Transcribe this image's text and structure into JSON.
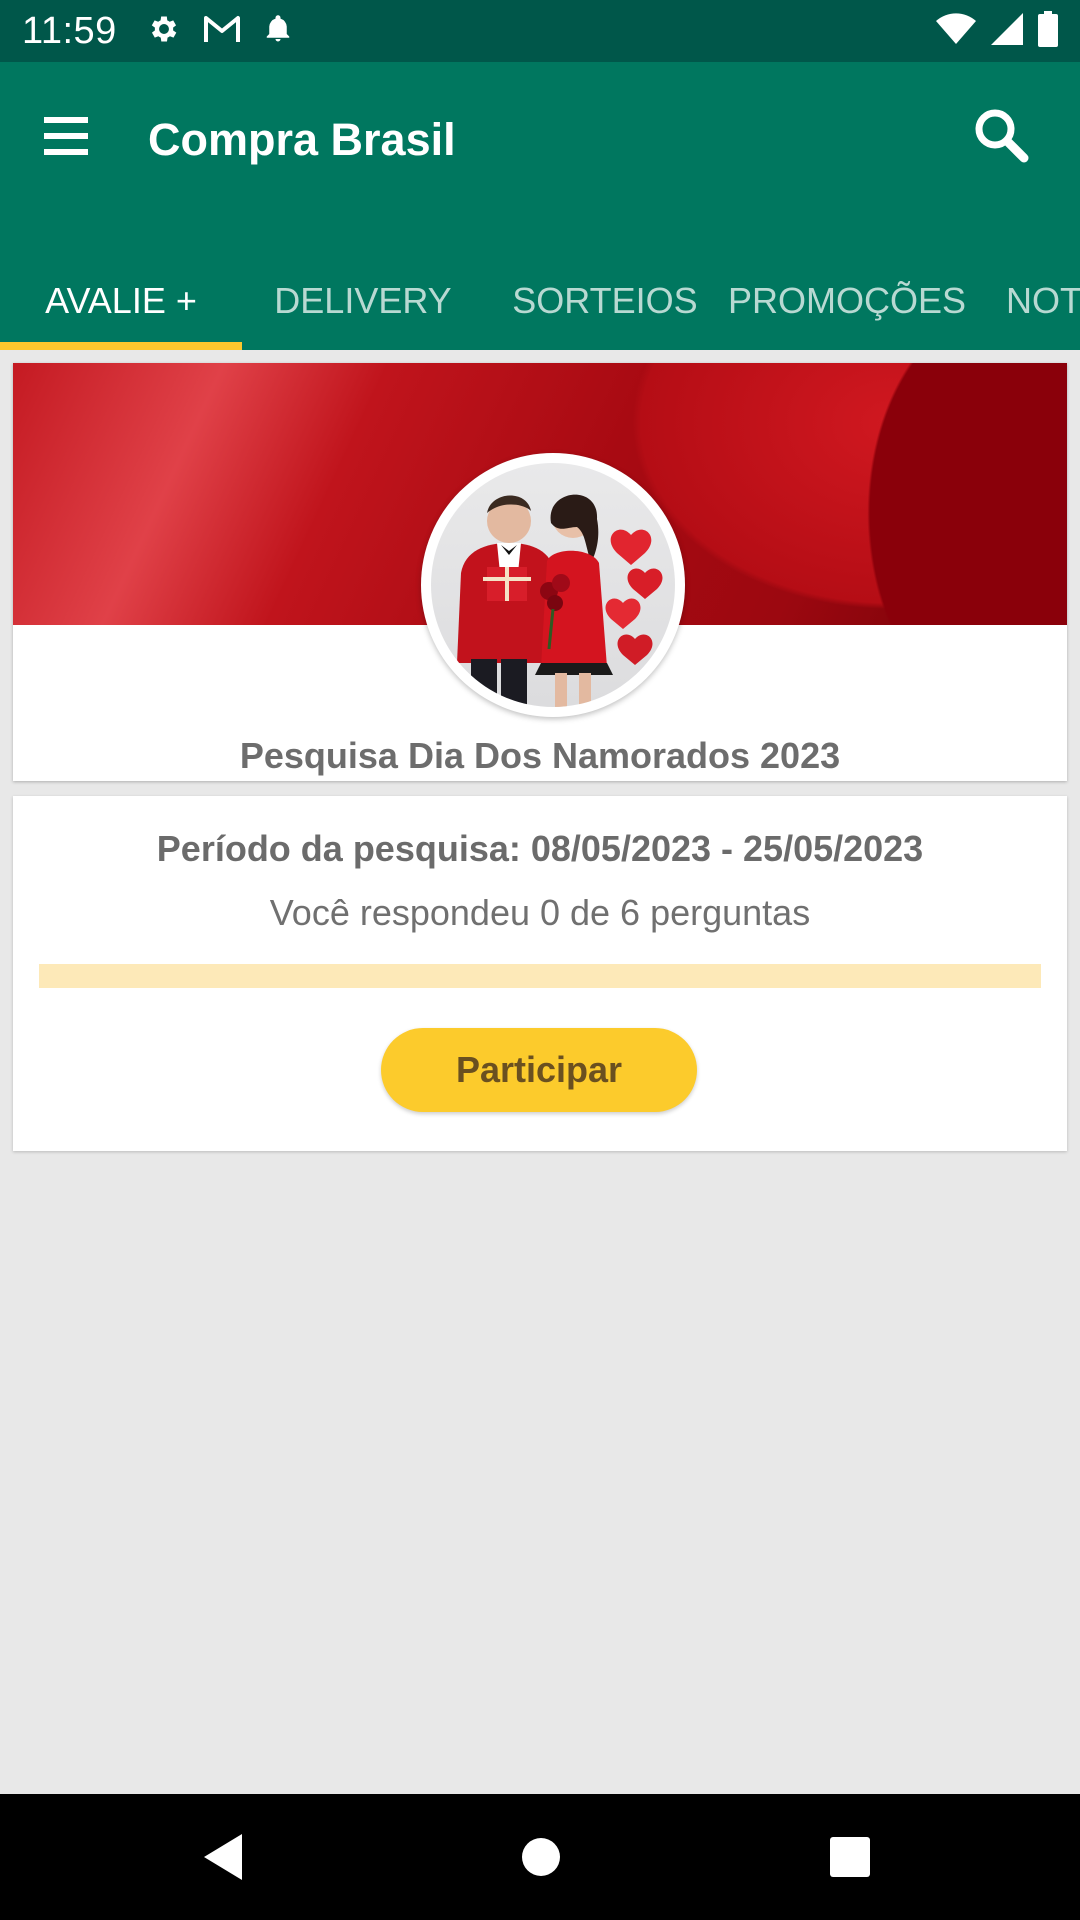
{
  "status_bar": {
    "time": "11:59",
    "icons_left": [
      "gear-icon",
      "gmail-icon",
      "bell-icon"
    ],
    "icons_right": [
      "wifi-icon",
      "signal-icon",
      "battery-icon"
    ]
  },
  "app_bar": {
    "title": "Compra Brasil",
    "menu_icon": "menu-icon",
    "search_icon": "search-icon",
    "background_color": "#00775f"
  },
  "tabs": [
    {
      "label": "AVALIE +",
      "active": true
    },
    {
      "label": "DELIVERY",
      "active": false
    },
    {
      "label": "SORTEIOS",
      "active": false
    },
    {
      "label": "PROMOÇÕES",
      "active": false
    },
    {
      "label": "NOT",
      "active": false
    }
  ],
  "tab_indicator_color": "#fcc82d",
  "survey": {
    "title": "Pesquisa Dia Dos Namorados 2023",
    "period": "Período da pesquisa: 08/05/2023 - 25/05/2023",
    "answered_text": "Você respondeu 0 de 6 perguntas",
    "answered": 0,
    "total": 6,
    "progress_fraction": 0,
    "button_label": "Participar",
    "button_color": "#fccb2c"
  },
  "nav_bar": {
    "icons": [
      "back-icon",
      "home-icon",
      "recents-icon"
    ]
  }
}
